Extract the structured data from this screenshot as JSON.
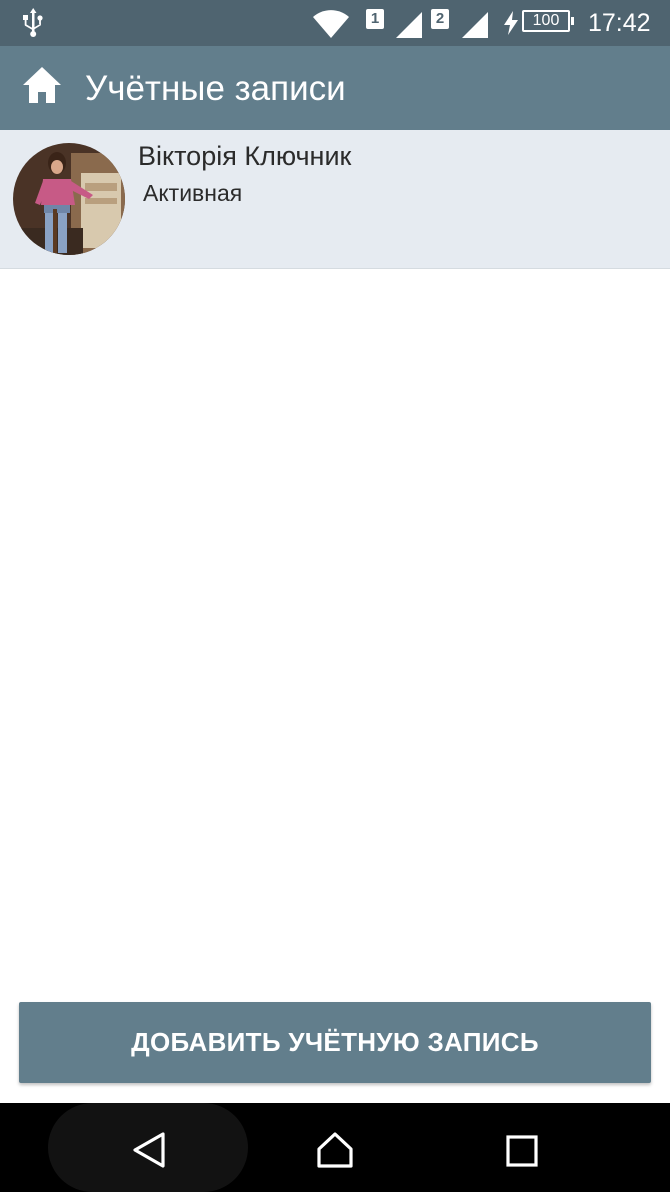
{
  "status_bar": {
    "sim1": "1",
    "sim2": "2",
    "battery": "100",
    "time": "17:42",
    "icons": [
      "usb-icon",
      "wifi-icon",
      "signal-icon",
      "charging-icon",
      "battery-icon"
    ]
  },
  "toolbar": {
    "title": "Учётные записи",
    "icon": "home-icon"
  },
  "accounts": [
    {
      "name": "Вікторія Ключник",
      "status": "Активная"
    }
  ],
  "add_button": {
    "label": "ДОБАВИТЬ УЧЁТНУЮ ЗАПИСЬ"
  },
  "nav_bar": {
    "icons": [
      "back-icon",
      "home-icon",
      "recents-icon"
    ]
  },
  "colors": {
    "status_bar": "#4f6470",
    "toolbar": "#627e8c",
    "account_row": "#e6ebf1",
    "button": "#627e8c"
  }
}
